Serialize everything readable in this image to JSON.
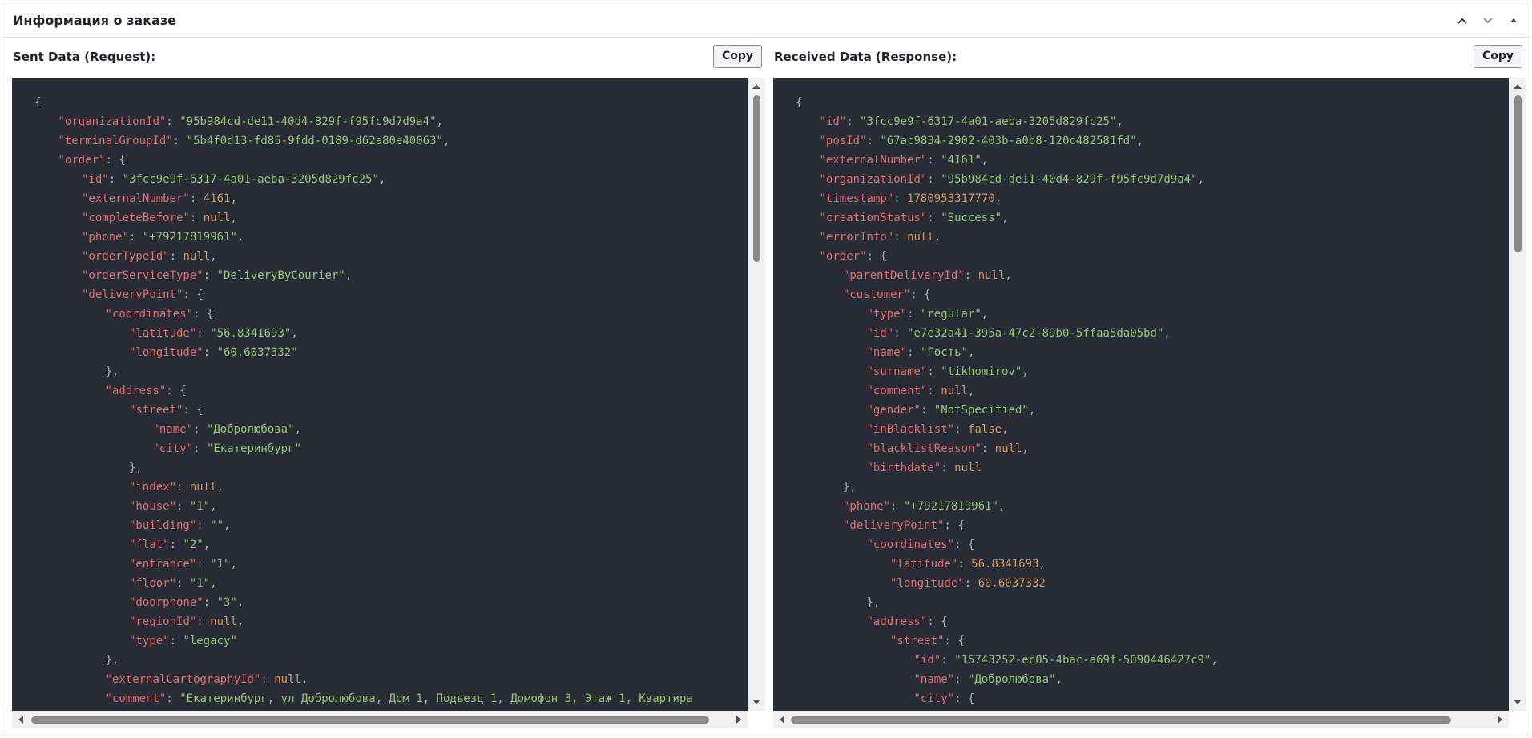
{
  "panel": {
    "title": "Информация о заказе",
    "controls": [
      {
        "name": "chevron-up-icon"
      },
      {
        "name": "chevron-down-icon"
      },
      {
        "name": "collapse-triangle-icon"
      }
    ]
  },
  "request": {
    "label": "Sent Data (Request):",
    "copy_label": "Copy",
    "lines": [
      [
        {
          "t": "p",
          "v": "{"
        }
      ],
      [
        {
          "t": "k",
          "v": "\"organizationId\""
        },
        {
          "t": "p",
          "v": ": "
        },
        {
          "t": "s",
          "v": "\"95b984cd-de11-40d4-829f-f95fc9d7d9a4\""
        },
        {
          "t": "p",
          "v": ","
        }
      ],
      [
        {
          "t": "k",
          "v": "\"terminalGroupId\""
        },
        {
          "t": "p",
          "v": ": "
        },
        {
          "t": "s",
          "v": "\"5b4f0d13-fd85-9fdd-0189-d62a80e40063\""
        },
        {
          "t": "p",
          "v": ","
        }
      ],
      [
        {
          "t": "k",
          "v": "\"order\""
        },
        {
          "t": "p",
          "v": ": {"
        }
      ],
      [
        {
          "t": "k",
          "v": "\"id\""
        },
        {
          "t": "p",
          "v": ": "
        },
        {
          "t": "s",
          "v": "\"3fcc9e9f-6317-4a01-aeba-3205d829fc25\""
        },
        {
          "t": "p",
          "v": ","
        }
      ],
      [
        {
          "t": "k",
          "v": "\"externalNumber\""
        },
        {
          "t": "p",
          "v": ": "
        },
        {
          "t": "n",
          "v": "4161"
        },
        {
          "t": "p",
          "v": ","
        }
      ],
      [
        {
          "t": "k",
          "v": "\"completeBefore\""
        },
        {
          "t": "p",
          "v": ": "
        },
        {
          "t": "l",
          "v": "null"
        },
        {
          "t": "p",
          "v": ","
        }
      ],
      [
        {
          "t": "k",
          "v": "\"phone\""
        },
        {
          "t": "p",
          "v": ": "
        },
        {
          "t": "s",
          "v": "\"+79217819961\""
        },
        {
          "t": "p",
          "v": ","
        }
      ],
      [
        {
          "t": "k",
          "v": "\"orderTypeId\""
        },
        {
          "t": "p",
          "v": ": "
        },
        {
          "t": "l",
          "v": "null"
        },
        {
          "t": "p",
          "v": ","
        }
      ],
      [
        {
          "t": "k",
          "v": "\"orderServiceType\""
        },
        {
          "t": "p",
          "v": ": "
        },
        {
          "t": "s",
          "v": "\"DeliveryByCourier\""
        },
        {
          "t": "p",
          "v": ","
        }
      ],
      [
        {
          "t": "k",
          "v": "\"deliveryPoint\""
        },
        {
          "t": "p",
          "v": ": {"
        }
      ],
      [
        {
          "t": "k",
          "v": "\"coordinates\""
        },
        {
          "t": "p",
          "v": ": {"
        }
      ],
      [
        {
          "t": "k",
          "v": "\"latitude\""
        },
        {
          "t": "p",
          "v": ": "
        },
        {
          "t": "s",
          "v": "\"56.8341693\""
        },
        {
          "t": "p",
          "v": ","
        }
      ],
      [
        {
          "t": "k",
          "v": "\"longitude\""
        },
        {
          "t": "p",
          "v": ": "
        },
        {
          "t": "s",
          "v": "\"60.6037332\""
        }
      ],
      [
        {
          "t": "p",
          "v": "},"
        }
      ],
      [
        {
          "t": "k",
          "v": "\"address\""
        },
        {
          "t": "p",
          "v": ": {"
        }
      ],
      [
        {
          "t": "k",
          "v": "\"street\""
        },
        {
          "t": "p",
          "v": ": {"
        }
      ],
      [
        {
          "t": "k",
          "v": "\"name\""
        },
        {
          "t": "p",
          "v": ": "
        },
        {
          "t": "s",
          "v": "\"Добролюбова\""
        },
        {
          "t": "p",
          "v": ","
        }
      ],
      [
        {
          "t": "k",
          "v": "\"city\""
        },
        {
          "t": "p",
          "v": ": "
        },
        {
          "t": "s",
          "v": "\"Екатеринбург\""
        }
      ],
      [
        {
          "t": "p",
          "v": "},"
        }
      ],
      [
        {
          "t": "k",
          "v": "\"index\""
        },
        {
          "t": "p",
          "v": ": "
        },
        {
          "t": "l",
          "v": "null"
        },
        {
          "t": "p",
          "v": ","
        }
      ],
      [
        {
          "t": "k",
          "v": "\"house\""
        },
        {
          "t": "p",
          "v": ": "
        },
        {
          "t": "s",
          "v": "\"1\""
        },
        {
          "t": "p",
          "v": ","
        }
      ],
      [
        {
          "t": "k",
          "v": "\"building\""
        },
        {
          "t": "p",
          "v": ": "
        },
        {
          "t": "s",
          "v": "\"\""
        },
        {
          "t": "p",
          "v": ","
        }
      ],
      [
        {
          "t": "k",
          "v": "\"flat\""
        },
        {
          "t": "p",
          "v": ": "
        },
        {
          "t": "s",
          "v": "\"2\""
        },
        {
          "t": "p",
          "v": ","
        }
      ],
      [
        {
          "t": "k",
          "v": "\"entrance\""
        },
        {
          "t": "p",
          "v": ": "
        },
        {
          "t": "s",
          "v": "\"1\""
        },
        {
          "t": "p",
          "v": ","
        }
      ],
      [
        {
          "t": "k",
          "v": "\"floor\""
        },
        {
          "t": "p",
          "v": ": "
        },
        {
          "t": "s",
          "v": "\"1\""
        },
        {
          "t": "p",
          "v": ","
        }
      ],
      [
        {
          "t": "k",
          "v": "\"doorphone\""
        },
        {
          "t": "p",
          "v": ": "
        },
        {
          "t": "s",
          "v": "\"3\""
        },
        {
          "t": "p",
          "v": ","
        }
      ],
      [
        {
          "t": "k",
          "v": "\"regionId\""
        },
        {
          "t": "p",
          "v": ": "
        },
        {
          "t": "l",
          "v": "null"
        },
        {
          "t": "p",
          "v": ","
        }
      ],
      [
        {
          "t": "k",
          "v": "\"type\""
        },
        {
          "t": "p",
          "v": ": "
        },
        {
          "t": "s",
          "v": "\"legacy\""
        }
      ],
      [
        {
          "t": "p",
          "v": "},"
        }
      ],
      [
        {
          "t": "k",
          "v": "\"externalCartographyId\""
        },
        {
          "t": "p",
          "v": ": "
        },
        {
          "t": "l",
          "v": "null"
        },
        {
          "t": "p",
          "v": ","
        }
      ],
      [
        {
          "t": "k",
          "v": "\"comment\""
        },
        {
          "t": "p",
          "v": ": "
        },
        {
          "t": "s",
          "v": "\"Екатеринбург, ул Добролюбова, Дом 1, Подъезд 1, Домофон 3, Этаж 1, Квартира"
        }
      ]
    ],
    "indents": [
      0,
      1,
      1,
      1,
      2,
      2,
      2,
      2,
      2,
      2,
      2,
      3,
      4,
      4,
      3,
      3,
      4,
      5,
      5,
      4,
      4,
      4,
      4,
      4,
      4,
      4,
      4,
      4,
      4,
      3,
      3,
      3
    ]
  },
  "response": {
    "label": "Received Data (Response):",
    "copy_label": "Copy",
    "lines": [
      [
        {
          "t": "p",
          "v": "{"
        }
      ],
      [
        {
          "t": "k",
          "v": "\"id\""
        },
        {
          "t": "p",
          "v": ": "
        },
        {
          "t": "s",
          "v": "\"3fcc9e9f-6317-4a01-aeba-3205d829fc25\""
        },
        {
          "t": "p",
          "v": ","
        }
      ],
      [
        {
          "t": "k",
          "v": "\"posId\""
        },
        {
          "t": "p",
          "v": ": "
        },
        {
          "t": "s",
          "v": "\"67ac9834-2902-403b-a0b8-120c482581fd\""
        },
        {
          "t": "p",
          "v": ","
        }
      ],
      [
        {
          "t": "k",
          "v": "\"externalNumber\""
        },
        {
          "t": "p",
          "v": ": "
        },
        {
          "t": "s",
          "v": "\"4161\""
        },
        {
          "t": "p",
          "v": ","
        }
      ],
      [
        {
          "t": "k",
          "v": "\"organizationId\""
        },
        {
          "t": "p",
          "v": ": "
        },
        {
          "t": "s",
          "v": "\"95b984cd-de11-40d4-829f-f95fc9d7d9a4\""
        },
        {
          "t": "p",
          "v": ","
        }
      ],
      [
        {
          "t": "k",
          "v": "\"timestamp\""
        },
        {
          "t": "p",
          "v": ": "
        },
        {
          "t": "n",
          "v": "1780953317770"
        },
        {
          "t": "p",
          "v": ","
        }
      ],
      [
        {
          "t": "k",
          "v": "\"creationStatus\""
        },
        {
          "t": "p",
          "v": ": "
        },
        {
          "t": "s",
          "v": "\"Success\""
        },
        {
          "t": "p",
          "v": ","
        }
      ],
      [
        {
          "t": "k",
          "v": "\"errorInfo\""
        },
        {
          "t": "p",
          "v": ": "
        },
        {
          "t": "l",
          "v": "null"
        },
        {
          "t": "p",
          "v": ","
        }
      ],
      [
        {
          "t": "k",
          "v": "\"order\""
        },
        {
          "t": "p",
          "v": ": {"
        }
      ],
      [
        {
          "t": "k",
          "v": "\"parentDeliveryId\""
        },
        {
          "t": "p",
          "v": ": "
        },
        {
          "t": "l",
          "v": "null"
        },
        {
          "t": "p",
          "v": ","
        }
      ],
      [
        {
          "t": "k",
          "v": "\"customer\""
        },
        {
          "t": "p",
          "v": ": {"
        }
      ],
      [
        {
          "t": "k",
          "v": "\"type\""
        },
        {
          "t": "p",
          "v": ": "
        },
        {
          "t": "s",
          "v": "\"regular\""
        },
        {
          "t": "p",
          "v": ","
        }
      ],
      [
        {
          "t": "k",
          "v": "\"id\""
        },
        {
          "t": "p",
          "v": ": "
        },
        {
          "t": "s",
          "v": "\"e7e32a41-395a-47c2-89b0-5ffaa5da05bd\""
        },
        {
          "t": "p",
          "v": ","
        }
      ],
      [
        {
          "t": "k",
          "v": "\"name\""
        },
        {
          "t": "p",
          "v": ": "
        },
        {
          "t": "s",
          "v": "\"Гость\""
        },
        {
          "t": "p",
          "v": ","
        }
      ],
      [
        {
          "t": "k",
          "v": "\"surname\""
        },
        {
          "t": "p",
          "v": ": "
        },
        {
          "t": "s",
          "v": "\"tikhomirov\""
        },
        {
          "t": "p",
          "v": ","
        }
      ],
      [
        {
          "t": "k",
          "v": "\"comment\""
        },
        {
          "t": "p",
          "v": ": "
        },
        {
          "t": "l",
          "v": "null"
        },
        {
          "t": "p",
          "v": ","
        }
      ],
      [
        {
          "t": "k",
          "v": "\"gender\""
        },
        {
          "t": "p",
          "v": ": "
        },
        {
          "t": "s",
          "v": "\"NotSpecified\""
        },
        {
          "t": "p",
          "v": ","
        }
      ],
      [
        {
          "t": "k",
          "v": "\"inBlacklist\""
        },
        {
          "t": "p",
          "v": ": "
        },
        {
          "t": "l",
          "v": "false"
        },
        {
          "t": "p",
          "v": ","
        }
      ],
      [
        {
          "t": "k",
          "v": "\"blacklistReason\""
        },
        {
          "t": "p",
          "v": ": "
        },
        {
          "t": "l",
          "v": "null"
        },
        {
          "t": "p",
          "v": ","
        }
      ],
      [
        {
          "t": "k",
          "v": "\"birthdate\""
        },
        {
          "t": "p",
          "v": ": "
        },
        {
          "t": "l",
          "v": "null"
        }
      ],
      [
        {
          "t": "p",
          "v": "},"
        }
      ],
      [
        {
          "t": "k",
          "v": "\"phone\""
        },
        {
          "t": "p",
          "v": ": "
        },
        {
          "t": "s",
          "v": "\"+79217819961\""
        },
        {
          "t": "p",
          "v": ","
        }
      ],
      [
        {
          "t": "k",
          "v": "\"deliveryPoint\""
        },
        {
          "t": "p",
          "v": ": {"
        }
      ],
      [
        {
          "t": "k",
          "v": "\"coordinates\""
        },
        {
          "t": "p",
          "v": ": {"
        }
      ],
      [
        {
          "t": "k",
          "v": "\"latitude\""
        },
        {
          "t": "p",
          "v": ": "
        },
        {
          "t": "n",
          "v": "56.8341693"
        },
        {
          "t": "p",
          "v": ","
        }
      ],
      [
        {
          "t": "k",
          "v": "\"longitude\""
        },
        {
          "t": "p",
          "v": ": "
        },
        {
          "t": "n",
          "v": "60.6037332"
        }
      ],
      [
        {
          "t": "p",
          "v": "},"
        }
      ],
      [
        {
          "t": "k",
          "v": "\"address\""
        },
        {
          "t": "p",
          "v": ": {"
        }
      ],
      [
        {
          "t": "k",
          "v": "\"street\""
        },
        {
          "t": "p",
          "v": ": {"
        }
      ],
      [
        {
          "t": "k",
          "v": "\"id\""
        },
        {
          "t": "p",
          "v": ": "
        },
        {
          "t": "s",
          "v": "\"15743252-ec05-4bac-a69f-5090446427c9\""
        },
        {
          "t": "p",
          "v": ","
        }
      ],
      [
        {
          "t": "k",
          "v": "\"name\""
        },
        {
          "t": "p",
          "v": ": "
        },
        {
          "t": "s",
          "v": "\"Добролюбова\""
        },
        {
          "t": "p",
          "v": ","
        }
      ],
      [
        {
          "t": "k",
          "v": "\"city\""
        },
        {
          "t": "p",
          "v": ": {"
        }
      ]
    ],
    "indents": [
      0,
      1,
      1,
      1,
      1,
      1,
      1,
      1,
      1,
      2,
      2,
      3,
      3,
      3,
      3,
      3,
      3,
      3,
      3,
      3,
      2,
      2,
      2,
      3,
      4,
      4,
      3,
      3,
      4,
      5,
      5,
      5
    ]
  }
}
